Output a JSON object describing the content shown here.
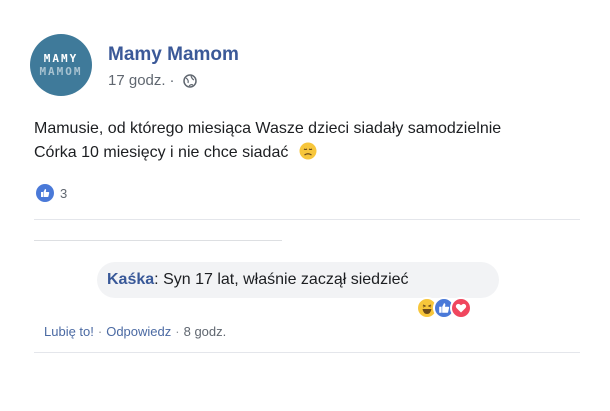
{
  "post": {
    "page_name": "Mamy Mamom",
    "avatar_line1": "MAMY",
    "avatar_line2": "MAMOM",
    "time": "17 godz.",
    "meta_sep": "·",
    "globe_icon": "globe-icon",
    "text_line1": "Mamusie, od którego miesiąca Wasze dzieci siadały samodzielnie",
    "text_line2": "Córka 10 miesięcy i nie chce siadać",
    "emoji": "sad-face-emoji",
    "like_count": "3"
  },
  "comment": {
    "author": "Kaśka",
    "separator": ":",
    "text": "Syn 17 lat, właśnie zaczął siedzieć",
    "reactions": [
      "haha-icon",
      "like-icon",
      "love-icon"
    ],
    "actions": {
      "like": "Lubię to!",
      "reply": "Odpowiedz",
      "time": "8 godz.",
      "sep": "·"
    }
  },
  "colors": {
    "name_blue": "#3b5998",
    "avatar_bg": "#3f7a9a",
    "bubble_bg": "#f2f3f5",
    "like_blue": "#4a79d8"
  }
}
